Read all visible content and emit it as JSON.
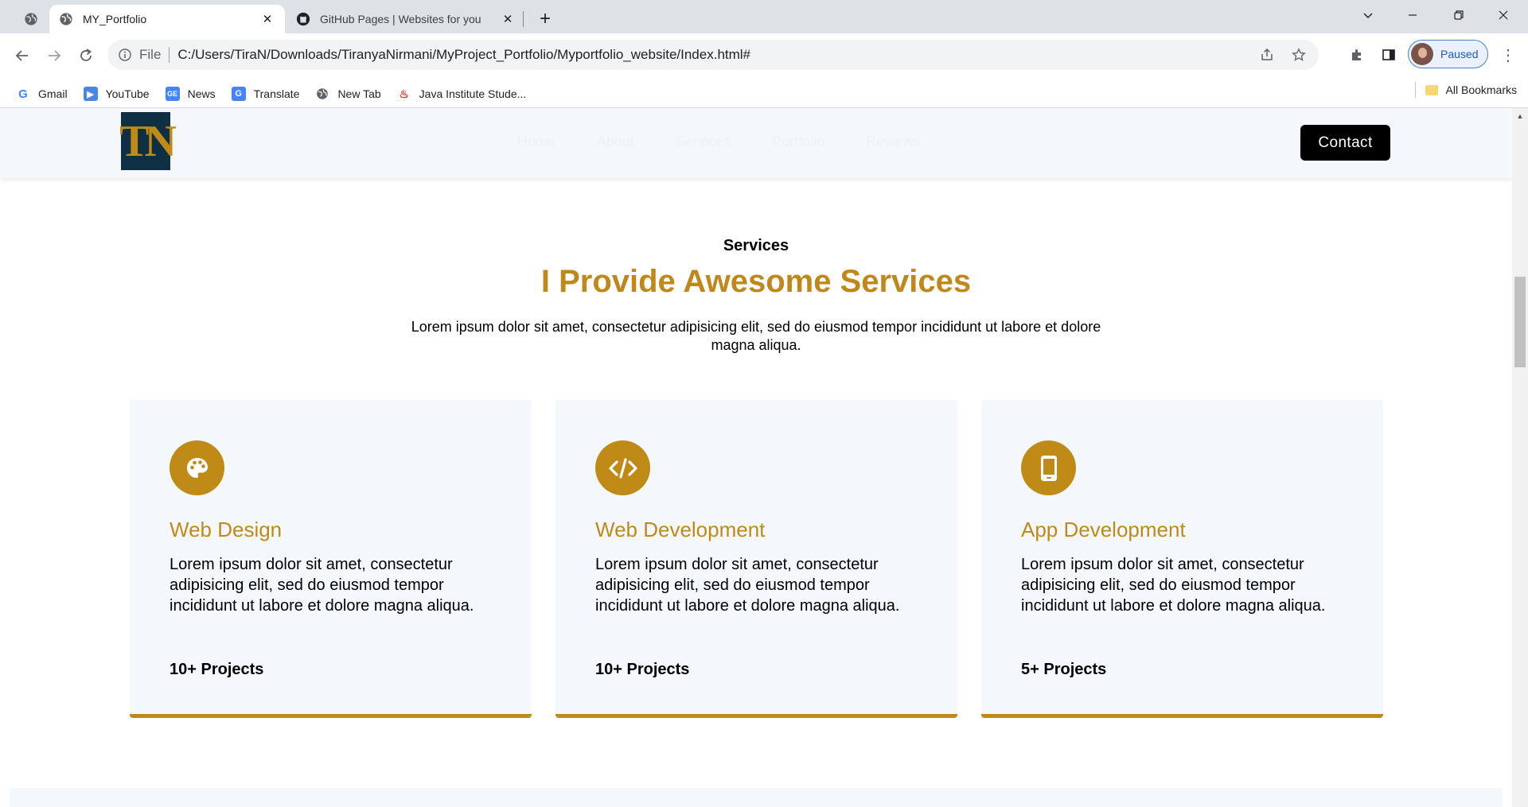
{
  "browser": {
    "tabs": [
      {
        "title": "MY_Portfolio",
        "active": true
      },
      {
        "title": "GitHub Pages | Websites for you",
        "active": false
      }
    ],
    "omnibox": {
      "scheme_label": "File",
      "url": "C:/Users/TiraN/Downloads/TiranyaNirmani/MyProject_Portfolio/Myportfolio_website/Index.html#"
    },
    "profile": {
      "status": "Paused"
    },
    "bookmarks": [
      {
        "label": "Gmail",
        "icon": "google-icon"
      },
      {
        "label": "YouTube",
        "icon": "youtube-icon"
      },
      {
        "label": "News",
        "icon": "news-icon"
      },
      {
        "label": "Translate",
        "icon": "translate-icon"
      },
      {
        "label": "New Tab",
        "icon": "globe-icon"
      },
      {
        "label": "Java Institute Stude...",
        "icon": "java-icon"
      }
    ],
    "all_bookmarks": "All Bookmarks"
  },
  "site": {
    "logo_text": "TN",
    "nav": [
      "Home",
      "About",
      "Services",
      "Portfolio",
      "Reviews"
    ],
    "contact_label": "Contact"
  },
  "services": {
    "subtitle": "Services",
    "title": "I Provide Awesome Services",
    "description": "Lorem ipsum dolor sit amet, consectetur adipisicing elit, sed do eiusmod tempor incididunt ut labore et dolore magna aliqua.",
    "cards": [
      {
        "icon": "palette-icon",
        "title": "Web Design",
        "text": "Lorem ipsum dolor sit amet, consectetur adipisicing elit, sed do eiusmod tempor incididunt ut labore et dolore magna aliqua.",
        "projects": "10+ Projects"
      },
      {
        "icon": "code-icon",
        "title": "Web Development",
        "text": "Lorem ipsum dolor sit amet, consectetur adipisicing elit, sed do eiusmod tempor incididunt ut labore et dolore magna aliqua.",
        "projects": "10+ Projects"
      },
      {
        "icon": "mobile-icon",
        "title": "App Development",
        "text": "Lorem ipsum dolor sit amet, consectetur adipisicing elit, sed do eiusmod tempor incididunt ut labore et dolore magna aliqua.",
        "projects": "5+ Projects"
      }
    ]
  },
  "colors": {
    "accent": "#c08a16",
    "header_bg": "#f4f7fb",
    "logo_bg": "#0f2f44"
  }
}
